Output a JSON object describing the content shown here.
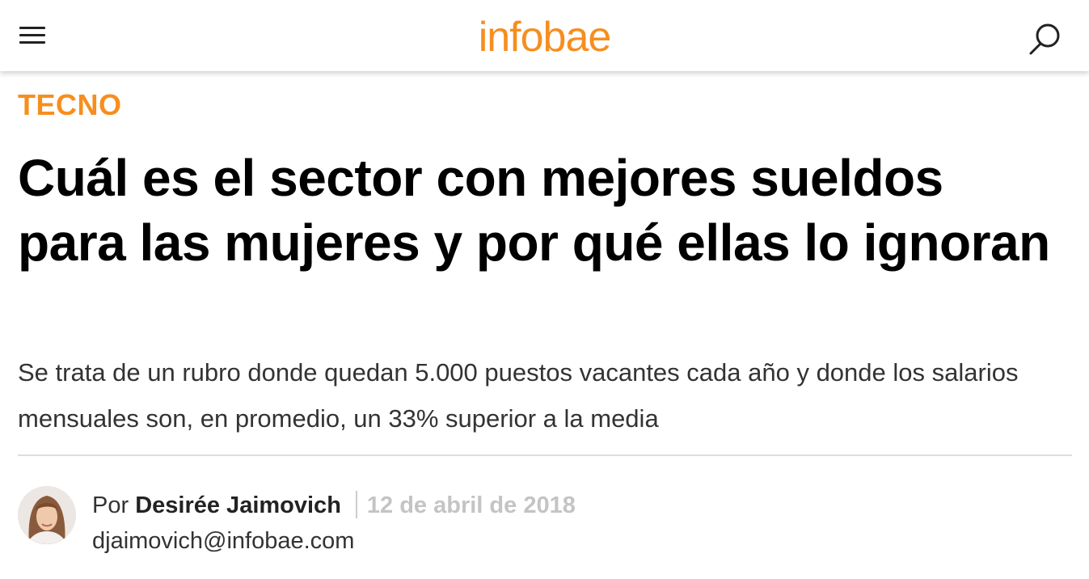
{
  "colors": {
    "brand": "#f68e1f",
    "text": "#000000",
    "muted": "#c4c4c4"
  },
  "header": {
    "logo_text": "infobae",
    "menu_icon": "hamburger-menu-icon",
    "search_icon": "search-icon"
  },
  "article": {
    "section": "TECNO",
    "headline": "Cuál es el sector con mejores sueldos para las mujeres y por qué ellas lo ignoran",
    "subtitle": "Se trata de un rubro donde quedan 5.000 puestos vacantes cada año y donde los salarios mensuales son, en promedio, un 33% superior a la media",
    "author": {
      "prefix": "Por",
      "name": "Desirée Jaimovich",
      "date": "12 de abril de 2018",
      "email": "djaimovich@infobae.com"
    }
  }
}
